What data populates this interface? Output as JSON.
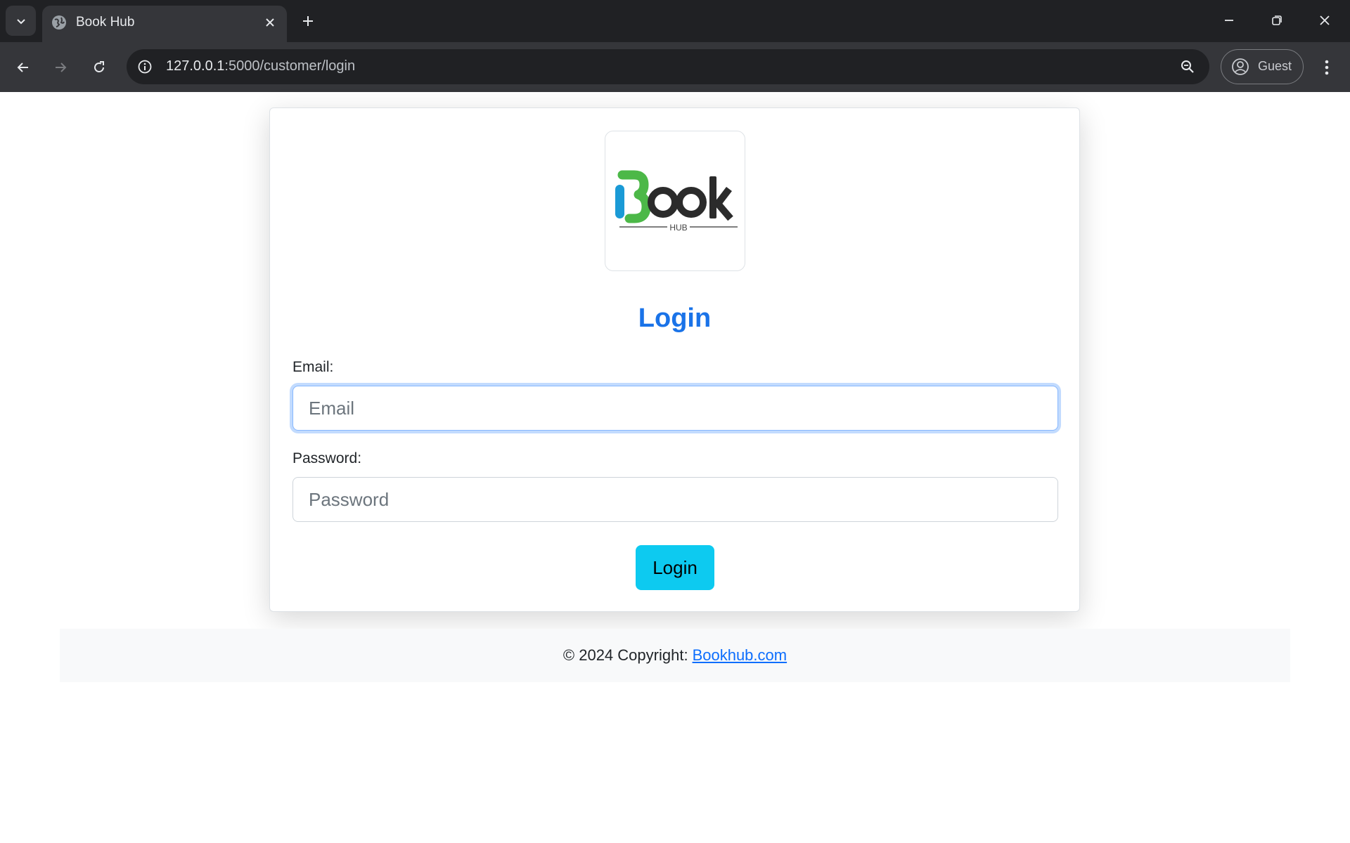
{
  "browser": {
    "tab_title": "Book Hub",
    "url_host": "127.0.0.1",
    "url_rest": ":5000/customer/login",
    "profile_label": "Guest"
  },
  "page": {
    "logo": {
      "word": "Book",
      "tagline": "HUB",
      "colors": {
        "i": "#1a9ad6",
        "b": "#4cb848",
        "text": "#2b2b2b"
      }
    },
    "heading": "Login",
    "email_label": "Email:",
    "email_placeholder": "Email",
    "email_value": "",
    "password_label": "Password:",
    "password_placeholder": "Password",
    "password_value": "",
    "login_button": "Login",
    "footer_prefix": "© 2024 Copyright:",
    "footer_link": "Bookhub.com"
  },
  "colors": {
    "heading": "#1a73e8",
    "button": "#0dcaf0",
    "link": "#0d6efd",
    "footer_bg": "#f8f9fa"
  }
}
